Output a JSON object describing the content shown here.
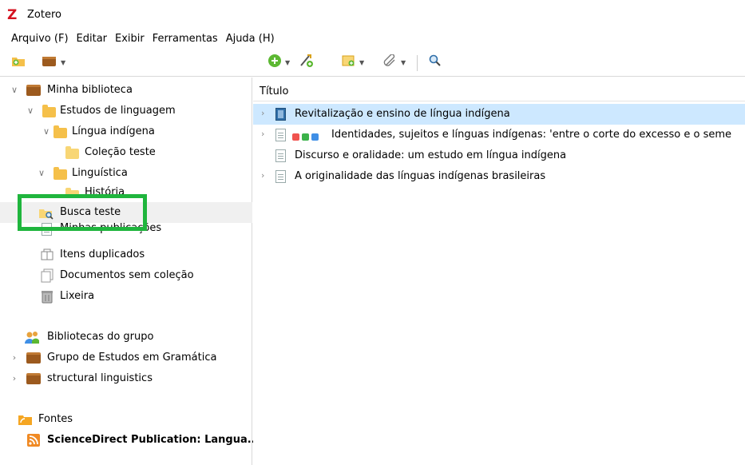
{
  "app": {
    "logo": "Z",
    "title": "Zotero"
  },
  "menu": [
    "Arquivo (F)",
    "Editar",
    "Exibir",
    "Ferramentas",
    "Ajuda (H)"
  ],
  "colors": {
    "highlight": "#1fb53d",
    "selected_item": "#cde8ff",
    "folder": "#f5c04a",
    "library": "#9c5a1e",
    "tag_colors": [
      "#f0534f",
      "#3bb24a",
      "#3f8fe6"
    ]
  },
  "toolbar": {
    "icons": [
      "new-collection-icon",
      "new-library-icon",
      "new-item-icon",
      "add-by-identifier-icon",
      "new-note-icon",
      "attachment-icon",
      "search-icon"
    ]
  },
  "sidebar": {
    "items": [
      {
        "label": "Minha biblioteca",
        "icon": "library-icon"
      },
      {
        "label": "Estudos de linguagem",
        "icon": "folder-icon"
      },
      {
        "label": "Língua indígena",
        "icon": "folder-icon"
      },
      {
        "label": "Coleção teste",
        "icon": "folder-icon"
      },
      {
        "label": "Linguística",
        "icon": "folder-icon"
      },
      {
        "label": "História",
        "icon": "folder-icon"
      },
      {
        "label": "Busca teste",
        "icon": "saved-search-icon"
      },
      {
        "label": "Minhas publicações",
        "icon": "publications-icon"
      },
      {
        "label": "Itens duplicados",
        "icon": "duplicates-icon"
      },
      {
        "label": "Documentos sem coleção",
        "icon": "unfiled-icon"
      },
      {
        "label": "Lixeira",
        "icon": "trash-icon"
      },
      {
        "label": "Bibliotecas do grupo",
        "icon": "group-icon"
      },
      {
        "label": "Grupo de Estudos em Gramática",
        "icon": "library-icon"
      },
      {
        "label": "structural linguistics",
        "icon": "library-icon"
      },
      {
        "label": "Fontes",
        "icon": "feeds-icon"
      },
      {
        "label": "ScienceDirect Publication: Langua...",
        "icon": "rss-icon"
      }
    ]
  },
  "items_header": "Título",
  "items": [
    {
      "title": "Revitalização e ensino de língua indígena",
      "type": "book"
    },
    {
      "title": "Identidades, sujeitos e línguas indígenas: 'entre o corte do excesso e o seme",
      "type": "document"
    },
    {
      "title": "Discurso e oralidade: um estudo em língua indígena",
      "type": "document"
    },
    {
      "title": "A originalidade das línguas indígenas brasileiras",
      "type": "document"
    }
  ]
}
